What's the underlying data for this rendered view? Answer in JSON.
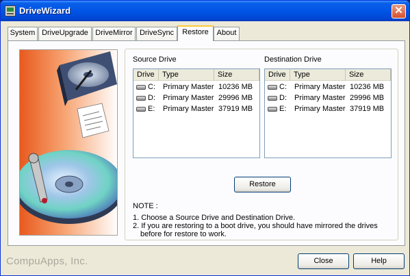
{
  "window": {
    "title": "DriveWizard"
  },
  "tabs": [
    {
      "label": "System"
    },
    {
      "label": "DriveUpgrade"
    },
    {
      "label": "DriveMirror"
    },
    {
      "label": "DriveSync"
    },
    {
      "label": "Restore",
      "active": true
    },
    {
      "label": "About"
    }
  ],
  "source": {
    "label": "Source Drive",
    "columns": [
      "Drive",
      "Type",
      "Size"
    ],
    "rows": [
      {
        "drive": "C:",
        "type": "Primary Master",
        "size": "10236 MB"
      },
      {
        "drive": "D:",
        "type": "Primary Master",
        "size": "29996 MB"
      },
      {
        "drive": "E:",
        "type": "Primary Master",
        "size": "37919 MB"
      }
    ]
  },
  "destination": {
    "label": "Destination Drive",
    "columns": [
      "Drive",
      "Type",
      "Size"
    ],
    "rows": [
      {
        "drive": "C:",
        "type": "Primary Master",
        "size": "10236 MB"
      },
      {
        "drive": "D:",
        "type": "Primary Master",
        "size": "29996 MB"
      },
      {
        "drive": "E:",
        "type": "Primary Master",
        "size": "37919 MB"
      }
    ]
  },
  "restore_button": "Restore",
  "note": {
    "title": "NOTE :",
    "lines": [
      "1. Choose a Source Drive and Destination Drive.",
      "2. If you are restoring to a boot drive, you should have mirrored the drives",
      "before for restore to work."
    ]
  },
  "footer": {
    "brand": "CompuApps, Inc.",
    "close_label": "Close",
    "help_label": "Help"
  },
  "colors": {
    "titlebar": "#0055e5",
    "tab_highlight": "#ffc83c",
    "face": "#ece9d8"
  }
}
